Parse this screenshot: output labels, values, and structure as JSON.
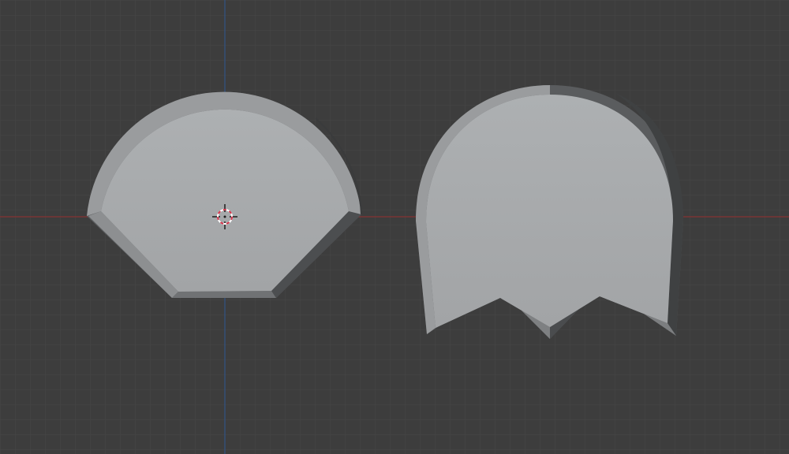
{
  "viewport": {
    "background": "#3d3d3d",
    "grid_minor_color": "#474747",
    "grid_major_color": "#515151",
    "x_axis_color": "#7a3434",
    "y_axis_color": "#34507a"
  },
  "objects": [
    {
      "name": "pac-shape-with-angled-bottom",
      "fill": "#a7a9ab"
    },
    {
      "name": "ghost-shape-with-zigzag-bottom",
      "fill": "#a7a9ab"
    }
  ],
  "cursor": {
    "icon": "3d-cursor-icon",
    "ring_color": "#d6334a"
  }
}
